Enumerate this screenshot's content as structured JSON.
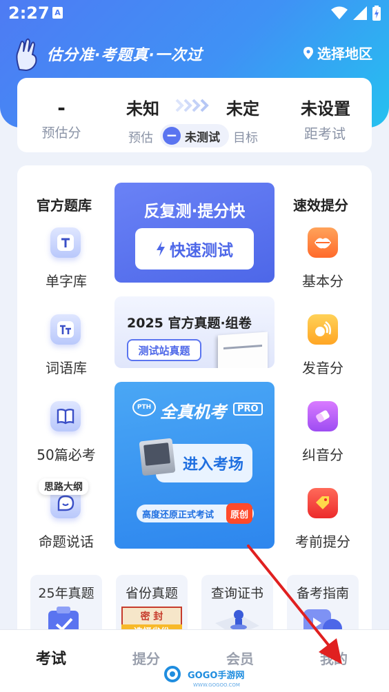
{
  "status": {
    "time": "2:27",
    "notification": "A"
  },
  "header": {
    "slogan": "估分准·考题真·一次过",
    "region": "选择地区"
  },
  "score": {
    "estimate_value": "-",
    "estimate_label": "预估分",
    "unknown": "未知",
    "undecided": "未定",
    "estimate_small": "预估",
    "untested": "未测试",
    "target_small": "目标",
    "not_set": "未设置",
    "distance": "距考试"
  },
  "left_column": {
    "title": "官方题库",
    "items": [
      {
        "label": "单字库",
        "icon": "T"
      },
      {
        "label": "词语库",
        "icon": "Tт"
      },
      {
        "label": "50篇必考",
        "icon": "book"
      },
      {
        "label": "命题说话",
        "icon": "chat",
        "badge": "思路大纲"
      }
    ]
  },
  "right_column": {
    "title": "速效提分",
    "items": [
      {
        "label": "基本分",
        "icon": "lips"
      },
      {
        "label": "发音分",
        "icon": "sound"
      },
      {
        "label": "纠音分",
        "icon": "eraser"
      },
      {
        "label": "考前提分",
        "icon": "tag"
      }
    ]
  },
  "quick_test": {
    "title": "反复测·提分快",
    "button": "快速测试"
  },
  "real_exam": {
    "title": "2025 官方真题·组卷",
    "button": "测试站真题"
  },
  "mock_exam": {
    "logo": "PTH",
    "title": "全真机考",
    "pro": "PRO",
    "button": "进入考场",
    "note": "高度还原正式考试",
    "tag": "原创"
  },
  "bottom_tiles": [
    {
      "label": "25年真题"
    },
    {
      "label": "省份真题",
      "sub": "选择省份",
      "stamp": "密 封"
    },
    {
      "label": "查询证书"
    },
    {
      "label": "备考指南"
    }
  ],
  "tabs": [
    {
      "label": "考试",
      "active": true
    },
    {
      "label": "提分",
      "active": false
    },
    {
      "label": "会员",
      "active": false
    },
    {
      "label": "我的",
      "active": false
    }
  ],
  "watermark": {
    "brand": "GOGO手游网",
    "url": "WWW.GOGOO.COM"
  },
  "colors": {
    "primary": "#4d67e8",
    "hero_start": "#4e7bf3",
    "hero_end": "#25c1f0",
    "arrow": "#e02020"
  }
}
